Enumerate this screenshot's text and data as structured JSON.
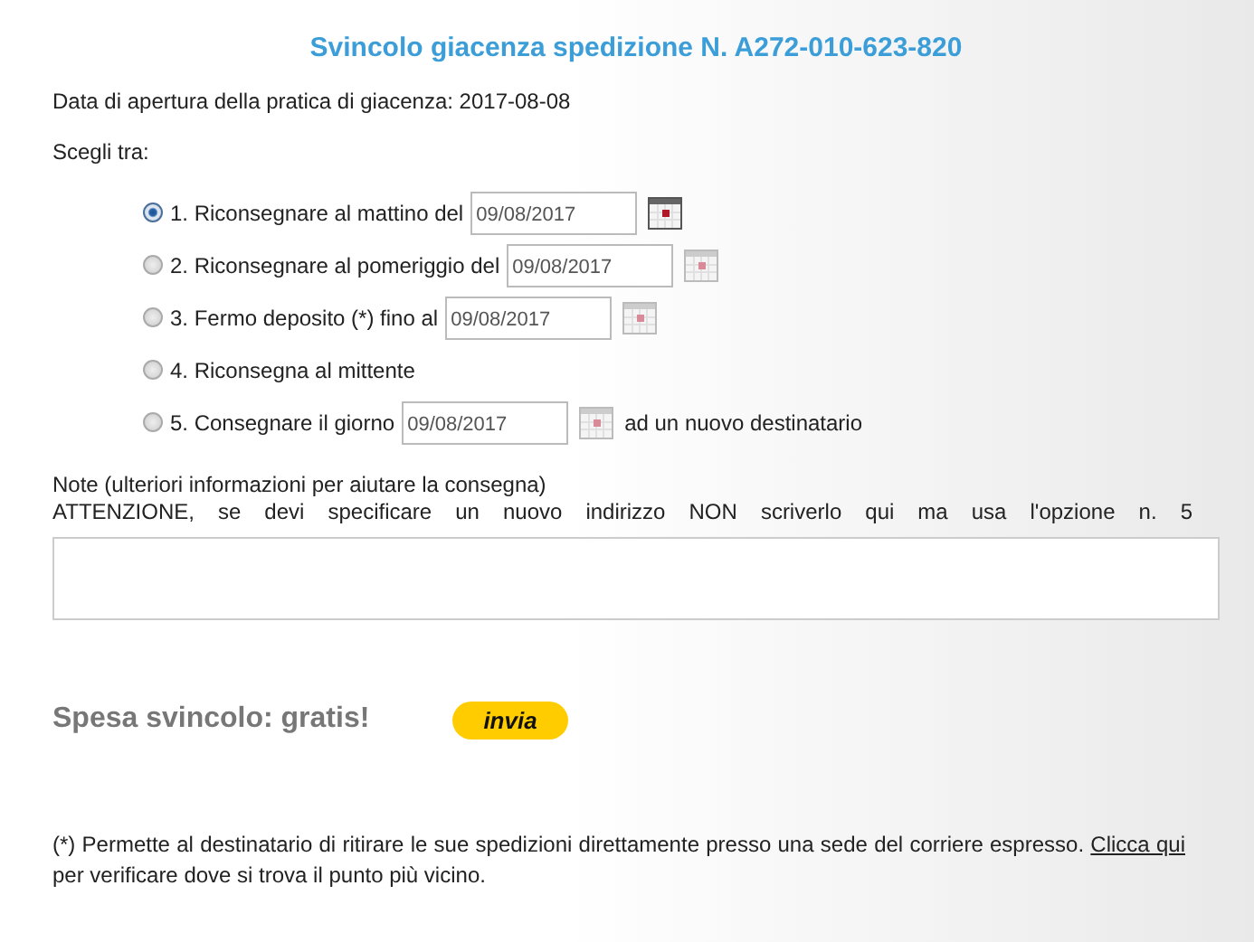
{
  "title": "Svincolo giacenza spedizione N. A272-010-623-820",
  "opening": "Data di apertura della pratica di giacenza: 2017-08-08",
  "choose_label": "Scegli tra:",
  "options": [
    {
      "label": "1. Riconsegnare al mattino del",
      "date": "09/08/2017",
      "selected": true
    },
    {
      "label": "2. Riconsegnare al pomeriggio del",
      "date": "09/08/2017",
      "selected": false
    },
    {
      "label": "3. Fermo deposito (*) fino al",
      "date": "09/08/2017",
      "selected": false
    },
    {
      "label": "4. Riconsegna al mittente",
      "selected": false
    },
    {
      "label": "5. Consegnare il giorno",
      "date": "09/08/2017",
      "suffix": "ad un nuovo destinatario",
      "selected": false
    }
  ],
  "notes": {
    "label": "Note (ulteriori informazioni per aiutare la consegna)",
    "warning": "ATTENZIONE, se devi specificare un nuovo indirizzo NON scriverlo qui ma usa l'opzione n. 5"
  },
  "cost": "Spesa svincolo: gratis!",
  "submit": "invia",
  "footer": {
    "text": "(*) Permette al destinatario di ritirare le sue spedizioni direttamente presso una sede del corriere espresso.",
    "link": "Clicca qui",
    "after": "per verificare dove si trova il punto più vicino."
  }
}
